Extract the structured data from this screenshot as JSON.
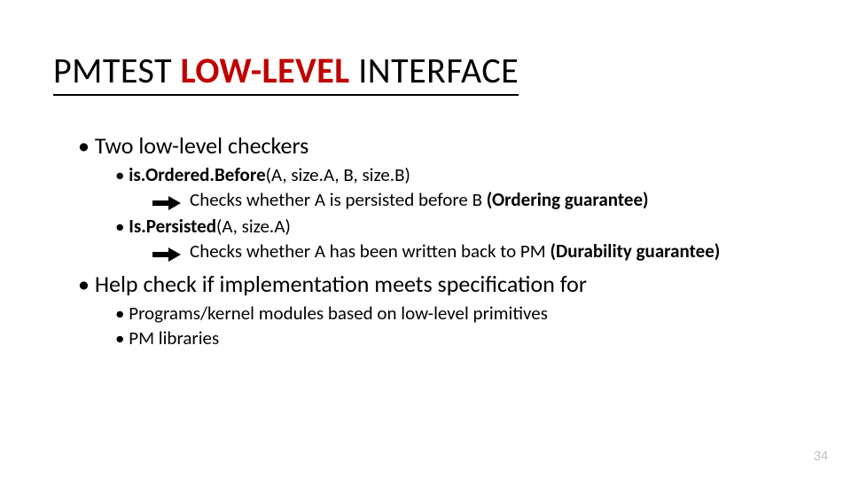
{
  "title": {
    "pm": "PM",
    "test": "TEST",
    "lowlevel": "LOW-LEVEL",
    "interface": " INTERFACE"
  },
  "bullets": {
    "b1a": "Two low-level checkers",
    "b2a_bold": "is.Ordered.Before",
    "b2a_rest": "(A, size.A, B, size.B)",
    "arrow1_text": "Checks whether A is persisted before B ",
    "arrow1_bold": "(Ordering guarantee)",
    "b2b_bold": "Is.Persisted",
    "b2b_rest": "(A, size.A)",
    "arrow2_text": "Checks whether A has been written back to PM ",
    "arrow2_bold": "(Durability guarantee)",
    "b1b": "Help check if implementation meets specification for",
    "b2c": "Programs/kernel modules based on low-level primitives",
    "b2d": "PM libraries"
  },
  "page": "34"
}
